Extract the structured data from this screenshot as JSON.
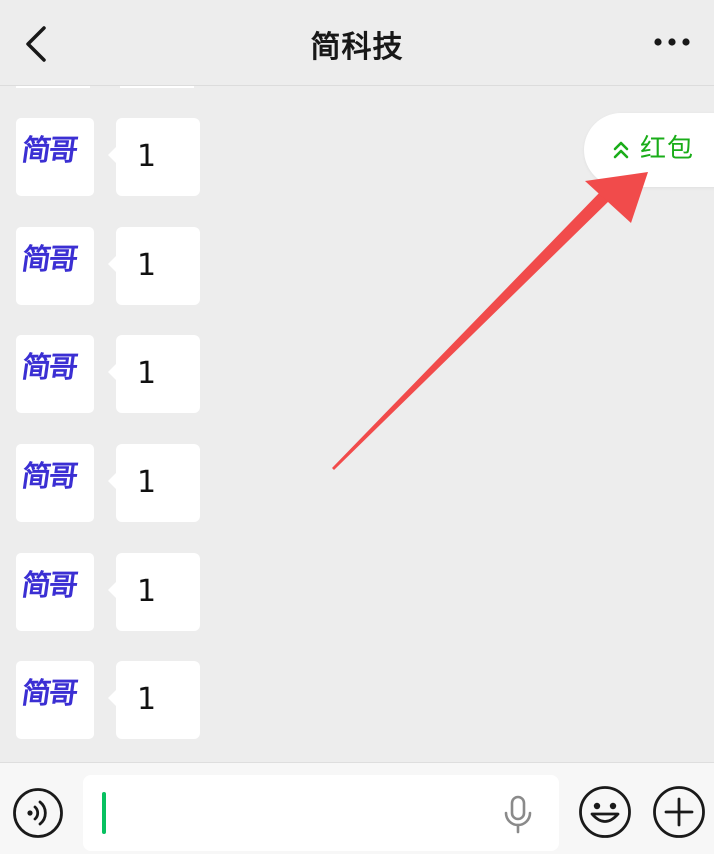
{
  "header": {
    "title": "简科技",
    "back_icon": "chevron-left-icon",
    "more_icon": "ellipsis-icon"
  },
  "messages": [
    {
      "avatar_text": "简哥",
      "text": "1"
    },
    {
      "avatar_text": "简哥",
      "text": "1"
    },
    {
      "avatar_text": "简哥",
      "text": "1"
    },
    {
      "avatar_text": "简哥",
      "text": "1"
    },
    {
      "avatar_text": "简哥",
      "text": "1"
    },
    {
      "avatar_text": "简哥",
      "text": "1"
    }
  ],
  "red_packet_tip": {
    "label": "红包",
    "icon": "double-chevron-up-icon",
    "color": "#1aad19"
  },
  "annotation": {
    "arrow_color": "#f14b4b"
  },
  "input_bar": {
    "voice_icon": "voice-icon",
    "mic_icon": "microphone-icon",
    "emoji_icon": "emoji-icon",
    "plus_icon": "plus-circle-icon",
    "cursor_color": "#07c160"
  },
  "colors": {
    "background": "#ededed",
    "avatar_text": "#3b2fd3"
  }
}
